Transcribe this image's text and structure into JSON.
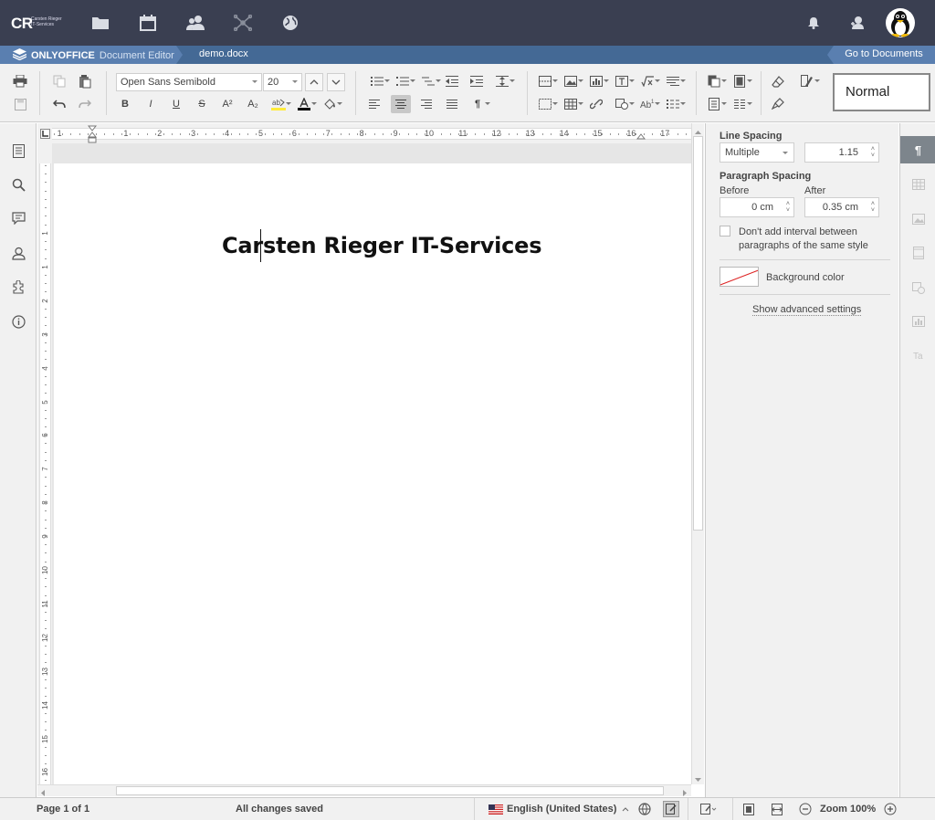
{
  "topnav": {
    "logo_initials": "CR",
    "logo_line1": "Carsten Rieger",
    "logo_line2": "IT-Services",
    "icons": [
      "folder-icon",
      "calendar-icon",
      "people-icon",
      "network-icon",
      "globe-icon",
      "bell-icon",
      "user-icon",
      "avatar"
    ]
  },
  "docbar": {
    "brand": "ONLYOFFICE",
    "editor": "Document Editor",
    "filename": "demo.docx",
    "goto_documents": "Go to Documents"
  },
  "toolbar": {
    "font_name": "Open Sans Semibold",
    "font_size": "20",
    "bold": "B",
    "italic": "I",
    "underline": "U",
    "strike": "S",
    "superscript": "A²",
    "subscript": "A₂",
    "style_name": "Normal"
  },
  "document": {
    "heading_before_cursor": "Car",
    "heading_after_cursor": "sten Rieger IT-Services"
  },
  "ruler": {
    "h_numbers": [
      "1",
      "1",
      "2",
      "3",
      "4",
      "5",
      "6",
      "7",
      "8",
      "9",
      "10",
      "11",
      "12",
      "13",
      "14",
      "15",
      "16",
      "17"
    ],
    "v_numbers": [
      "1",
      "1",
      "2",
      "3",
      "4",
      "5",
      "6",
      "7",
      "8",
      "9",
      "10",
      "11",
      "12",
      "13",
      "14",
      "15",
      "16"
    ]
  },
  "right_panel": {
    "line_spacing_title": "Line Spacing",
    "line_spacing_mode": "Multiple",
    "line_spacing_value": "1.15",
    "paragraph_spacing_title": "Paragraph Spacing",
    "before_label": "Before",
    "after_label": "After",
    "before_value": "0 cm",
    "after_value": "0.35 cm",
    "no_interval_label": "Don't add interval between paragraphs of the same style",
    "background_color_label": "Background color",
    "advanced_link": "Show advanced settings"
  },
  "statusbar": {
    "page_info": "Page 1 of 1",
    "save_status": "All changes saved",
    "language": "English (United States)",
    "zoom": "Zoom 100%"
  },
  "colors": {
    "topnav_bg": "#3a3f51",
    "docbar_bg": "#446995",
    "toolbar_bg": "#f1f1f1",
    "active_panel_icon": "#7d858c"
  }
}
